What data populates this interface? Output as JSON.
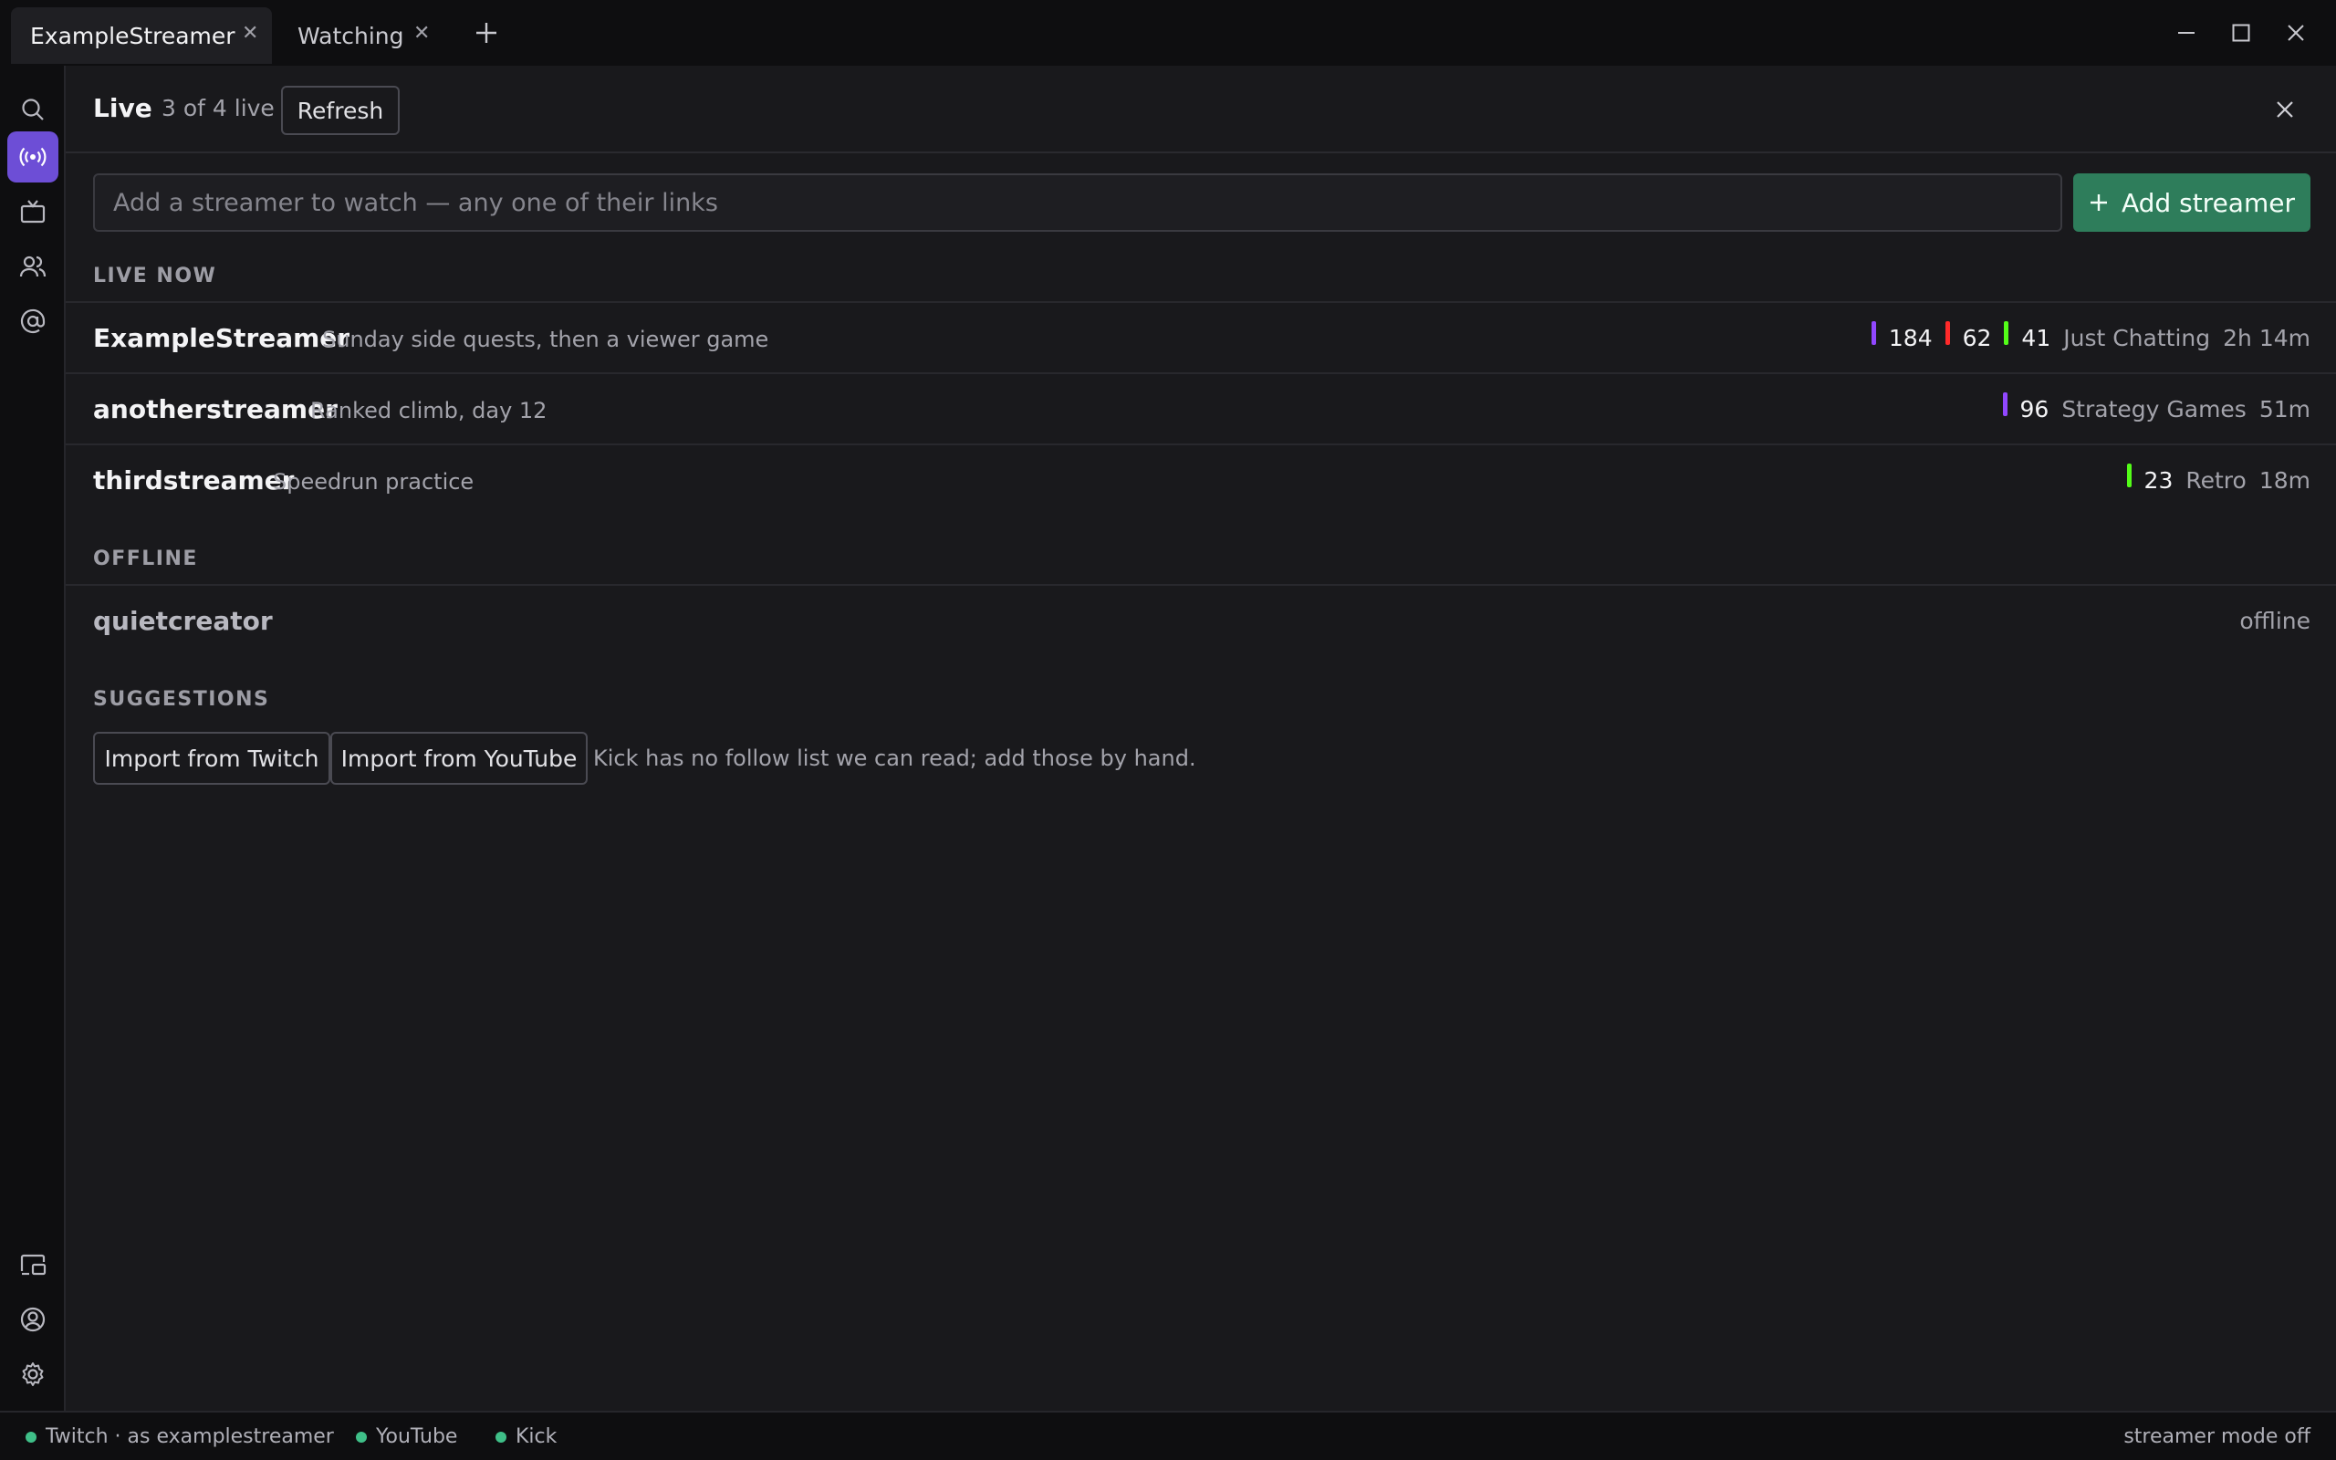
{
  "tabs": [
    {
      "label": "ExampleStreamer",
      "active": true
    },
    {
      "label": "Watching",
      "active": false
    }
  ],
  "header": {
    "title": "Live",
    "count": "3 of 4 live",
    "refresh_label": "Refresh"
  },
  "add": {
    "placeholder": "Add a streamer to watch — any one of their links",
    "button_label": "Add streamer"
  },
  "sections": {
    "live_now": "LIVE NOW",
    "offline": "OFFLINE",
    "suggestions": "SUGGESTIONS"
  },
  "live": [
    {
      "name": "ExampleStreamer",
      "title": "Sunday side quests, then a viewer game",
      "viewers": [
        {
          "platform": "twitch",
          "color": "#9147ff",
          "count": "184"
        },
        {
          "platform": "youtube",
          "color": "#ff2a2a",
          "count": "62"
        },
        {
          "platform": "kick",
          "color": "#53fc18",
          "count": "41"
        }
      ],
      "category": "Just Chatting",
      "uptime": "2h 14m"
    },
    {
      "name": "anotherstreamer",
      "title": "Ranked climb, day 12",
      "viewers": [
        {
          "platform": "twitch",
          "color": "#9147ff",
          "count": "96"
        }
      ],
      "category": "Strategy Games",
      "uptime": "51m"
    },
    {
      "name": "thirdstreamer",
      "title": "Speedrun practice",
      "viewers": [
        {
          "platform": "kick",
          "color": "#53fc18",
          "count": "23"
        }
      ],
      "category": "Retro",
      "uptime": "18m"
    }
  ],
  "offline": [
    {
      "name": "quietcreator",
      "status": "offline"
    }
  ],
  "suggestions": {
    "import_twitch": "Import from Twitch",
    "import_youtube": "Import from YouTube",
    "note": "Kick has no follow list we can read; add those by hand."
  },
  "statusbar": {
    "twitch": "Twitch · as examplestreamer",
    "youtube": "YouTube",
    "kick": "Kick",
    "mode": "streamer mode off"
  },
  "colors": {
    "accent": "#6d4ed6",
    "add_button": "#2e7d5b",
    "connected": "#3fbf88"
  }
}
